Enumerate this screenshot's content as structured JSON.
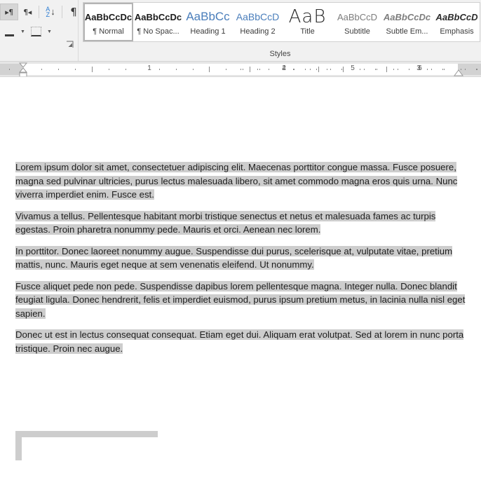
{
  "ribbon": {
    "paragraph_group": {
      "buttons": [
        {
          "name": "increase-indent",
          "glyph": "▸¶",
          "pressed": true
        },
        {
          "name": "decrease-indent",
          "glyph": "¶◂",
          "pressed": false
        },
        {
          "name": "sort",
          "glyph": "A/Z↓",
          "pressed": false
        },
        {
          "name": "show-formatting-marks",
          "glyph": "¶",
          "pressed": false
        },
        {
          "name": "shading",
          "glyph": "shade",
          "pressed": false
        },
        {
          "name": "borders",
          "glyph": "borders",
          "pressed": false
        }
      ],
      "dialog_launcher_label": "Paragraph Settings"
    },
    "styles_group": {
      "label": "Styles",
      "items": [
        {
          "preview": "AaBbCcDc",
          "label": "¶ Normal",
          "selected": true,
          "style": "pv-normal"
        },
        {
          "preview": "AaBbCcDc",
          "label": "¶ No Spac...",
          "selected": false,
          "style": "pv-nospace"
        },
        {
          "preview": "AaBbCc",
          "label": "Heading 1",
          "selected": false,
          "style": "pv-h1"
        },
        {
          "preview": "AaBbCcD",
          "label": "Heading 2",
          "selected": false,
          "style": "pv-h2"
        },
        {
          "preview": "AaB",
          "label": "Title",
          "selected": false,
          "style": "pv-title"
        },
        {
          "preview": "AaBbCcD",
          "label": "Subtitle",
          "selected": false,
          "style": "pv-subtitle"
        },
        {
          "preview": "AaBbCcDc",
          "label": "Subtle Em...",
          "selected": false,
          "style": "pv-subtleem"
        },
        {
          "preview": "AaBbCcD",
          "label": "Emphasis",
          "selected": false,
          "style": "pv-emphasis"
        }
      ]
    }
  },
  "ruler": {
    "numbers": [
      "1",
      "2",
      "3",
      "4",
      "5",
      "6"
    ],
    "left_indent_marker": "first-line-indent-marker",
    "right_indent_marker": "right-indent-marker"
  },
  "document": {
    "paragraphs": [
      "Lorem ipsum dolor sit amet, consectetuer adipiscing elit. Maecenas porttitor congue massa. Fusce posuere, magna sed pulvinar ultricies, purus lectus malesuada libero, sit amet commodo magna eros quis urna. Nunc viverra imperdiet enim. Fusce est.",
      "Vivamus a tellus. Pellentesque habitant morbi tristique senectus et netus et malesuada fames ac turpis egestas. Proin pharetra nonummy pede. Mauris et orci. Aenean nec lorem.",
      "In porttitor. Donec laoreet nonummy augue. Suspendisse dui purus, scelerisque at, vulputate vitae, pretium mattis, nunc. Mauris eget neque at sem venenatis eleifend. Ut nonummy.",
      "Fusce aliquet pede non pede. Suspendisse dapibus lorem pellentesque magna. Integer nulla. Donec blandit feugiat ligula. Donec hendrerit, felis et imperdiet euismod, purus ipsum pretium metus, in lacinia nulla nisl eget sapien.",
      "Donec ut est in lectus consequat consequat. Etiam eget dui. Aliquam erat volutpat. Sed at lorem in nunc porta tristique. Proin nec augue."
    ],
    "selection_color": "#cdcdcd"
  }
}
